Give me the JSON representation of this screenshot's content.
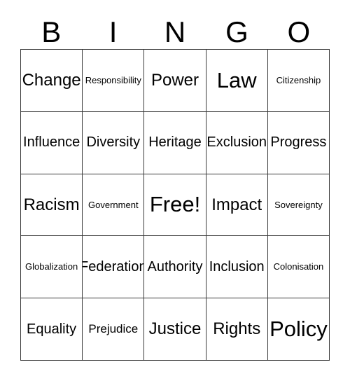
{
  "card": {
    "header_letters": [
      "B",
      "I",
      "N",
      "G",
      "O"
    ],
    "border_color": "#3a3a3a",
    "background_color": "#ffffff",
    "text_color": "#000000",
    "columns": 5,
    "rows": 5,
    "free_space": "Free!",
    "free_space_position": {
      "row": 3,
      "column": 3
    },
    "rows_data": [
      [
        {
          "label": "Change",
          "size": "lg"
        },
        {
          "label": "Responsibility",
          "size": "xs"
        },
        {
          "label": "Power",
          "size": "lg"
        },
        {
          "label": "Law",
          "size": "xl"
        },
        {
          "label": "Citizenship",
          "size": "xs"
        }
      ],
      [
        {
          "label": "Influence",
          "size": "md"
        },
        {
          "label": "Diversity",
          "size": "md"
        },
        {
          "label": "Heritage",
          "size": "md"
        },
        {
          "label": "Exclusion",
          "size": "md"
        },
        {
          "label": "Progress",
          "size": "md"
        }
      ],
      [
        {
          "label": "Racism",
          "size": "lg"
        },
        {
          "label": "Government",
          "size": "xs"
        },
        {
          "label": "Free!",
          "size": "xl"
        },
        {
          "label": "Impact",
          "size": "lg"
        },
        {
          "label": "Sovereignty",
          "size": "xs"
        }
      ],
      [
        {
          "label": "Globalization",
          "size": "xs"
        },
        {
          "label": "Federation",
          "size": "md"
        },
        {
          "label": "Authority",
          "size": "md"
        },
        {
          "label": "Inclusion",
          "size": "md"
        },
        {
          "label": "Colonisation",
          "size": "xs"
        }
      ],
      [
        {
          "label": "Equality",
          "size": "md"
        },
        {
          "label": "Prejudice",
          "size": "sm"
        },
        {
          "label": "Justice",
          "size": "lg"
        },
        {
          "label": "Rights",
          "size": "lg"
        },
        {
          "label": "Policy",
          "size": "xl"
        }
      ]
    ]
  }
}
